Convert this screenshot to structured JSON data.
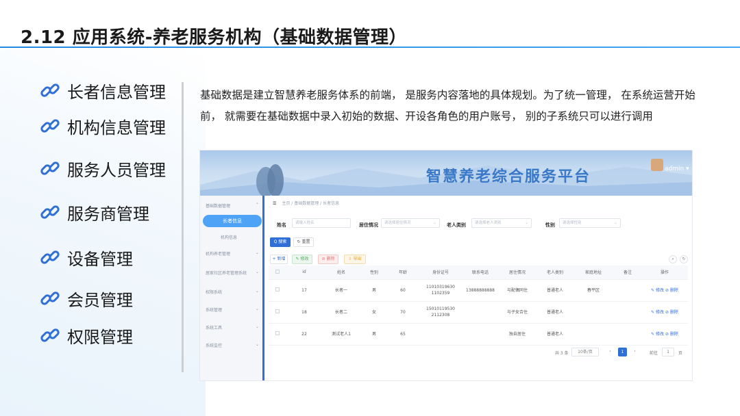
{
  "slide": {
    "title": "2.12 应用系统-养老服务机构（基础数据管理）",
    "menu": [
      {
        "label": "长者信息管理"
      },
      {
        "label": "机构信息管理"
      },
      {
        "label": "服务人员管理"
      },
      {
        "label": "服务商管理"
      },
      {
        "label": "设备管理"
      },
      {
        "label": "会员管理"
      },
      {
        "label": "权限管理"
      }
    ],
    "description": "基础数据是建立智慧养老服务体系的前端， 是服务内容落地的具体规划。为了统一管理， 在系统运营开始前， 就需要在基础数据中录入初始的数据、开设各角色的用户账号， 别的子系统只可以进行调用",
    "colors": {
      "accent": "#1e88e5",
      "app_primary": "#2f6fd6"
    }
  },
  "app": {
    "platform_title": "智慧养老综合服务平台",
    "user": "admin",
    "user_caret": "▾",
    "sidebar": {
      "items": [
        {
          "label": "基础数据管理",
          "chev": "⌃"
        },
        {
          "label": "长者信息"
        },
        {
          "label": "机构信息"
        },
        {
          "label": "机构养老管理",
          "chev": "⌄"
        },
        {
          "label": "居家社区养老管理系统",
          "chev": "⌄"
        },
        {
          "label": "权限系统",
          "chev": "⌄"
        },
        {
          "label": "系统管理",
          "chev": "⌄"
        },
        {
          "label": "系统工具",
          "chev": "⌄"
        },
        {
          "label": "系统监控",
          "chev": "⌄"
        }
      ]
    },
    "breadcrumb": {
      "icon": "☰",
      "items": [
        "主页",
        "基础数据管理",
        "长者信息"
      ],
      "sep": "/"
    },
    "filters": {
      "name_label": "姓名",
      "name_placeholder": "请输入姓名",
      "residence_label": "居住情况",
      "residence_placeholder": "请选择居住情况",
      "type_label": "老人类别",
      "type_placeholder": "请选择老人类别",
      "gender_label": "性别",
      "gender_placeholder": "请选择性别",
      "dropdown_icon": "⌄"
    },
    "actions": {
      "search": "Q 搜索",
      "reset": "↻ 重置",
      "add": "+ 新增",
      "edit": "✎ 修改",
      "delete": "⊘ 删除",
      "export": "⇩ 导出",
      "circle1": "⌕",
      "circle2": "↻"
    },
    "table": {
      "columns": [
        "id",
        "姓名",
        "性别",
        "年龄",
        "身份证号",
        "联系电话",
        "居住情况",
        "老人类别",
        "家庭地址",
        "备注",
        "操作"
      ],
      "rows": [
        {
          "id": "17",
          "name": "长者一",
          "gender": "男",
          "age": "60",
          "idcard1": "11010319630",
          "idcard2": "1102359",
          "phone": "13888888888",
          "residence": "与配偶同住",
          "type": "普通老人",
          "address": "春平区",
          "note": "",
          "ops": "✎ 修改 ⊘ 删除"
        },
        {
          "id": "18",
          "name": "长者二",
          "gender": "女",
          "age": "70",
          "idcard1": "15010119530",
          "idcard2": "2112308",
          "phone": "",
          "residence": "与子女合住",
          "type": "普通老人",
          "address": "",
          "note": "",
          "ops": "✎ 修改 ⊘ 删除"
        },
        {
          "id": "22",
          "name": "测试老人1",
          "gender": "男",
          "age": "65",
          "idcard1": "",
          "idcard2": "",
          "phone": "",
          "residence": "独自居住",
          "type": "普通老人",
          "address": "",
          "note": "",
          "ops": "✎ 修改 ⊘ 删除"
        }
      ]
    },
    "pagination": {
      "total": "共 3 条",
      "page_size": "10条/页",
      "prev": "‹",
      "current": "1",
      "next": "›",
      "goto_label": "前往",
      "goto_value": "1",
      "page_unit": "页"
    }
  }
}
